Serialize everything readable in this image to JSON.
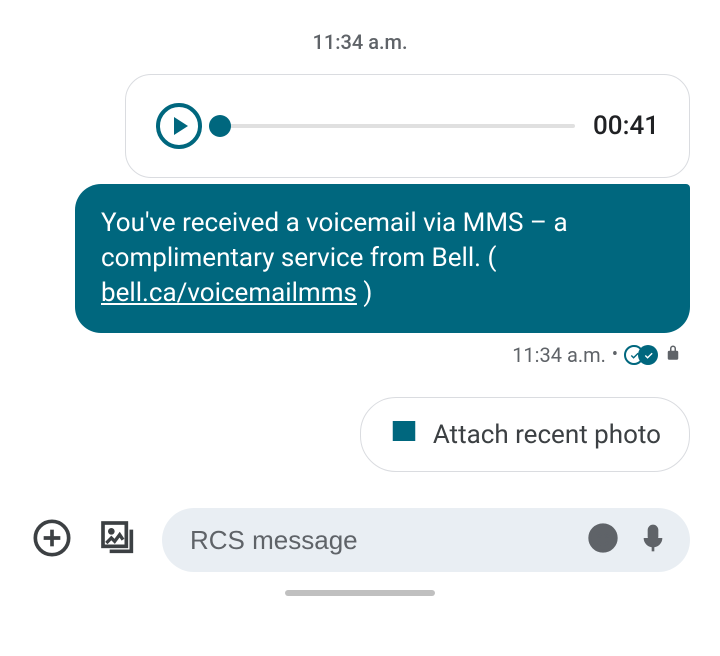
{
  "conversation": {
    "header_timestamp": "11:34 a.m.",
    "audio_message": {
      "duration": "00:41",
      "progress": 0
    },
    "text_message": {
      "prefix": "You've received a voicemail via MMS – a complimentary service from Bell. ( ",
      "link_text": "bell.ca/voicemailmms",
      "suffix": " )"
    },
    "status": {
      "timestamp": "11:34 a.m.",
      "delivered": true,
      "encrypted": true
    }
  },
  "suggestions": {
    "attach_label": "Attach recent photo"
  },
  "compose": {
    "placeholder": "RCS message"
  },
  "icons": {
    "play": "play-icon",
    "image": "image-icon",
    "lock": "lock-icon",
    "delivered": "delivered-double-check-icon",
    "plus": "plus-icon",
    "gallery": "gallery-icon",
    "emoji": "emoji-icon",
    "mic": "mic-icon"
  },
  "colors": {
    "accent": "#00677e",
    "bubble_bg": "#00677e",
    "border": "#dadce0",
    "text_muted": "#5f6368",
    "input_bg": "#e9eef3"
  }
}
